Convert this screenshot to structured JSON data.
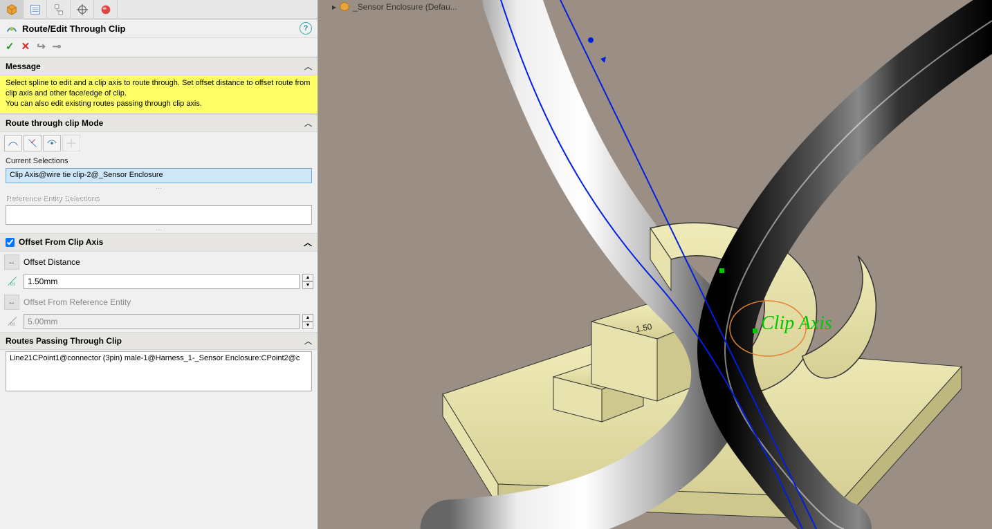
{
  "title": "Route/Edit Through Clip",
  "vp_title": "_Sensor Enclosure  (Defau...",
  "message": {
    "header": "Message",
    "body_l1": "Select spline to edit and a clip axis to route through. Set offset distance to offset route from clip axis and other face/edge of clip.",
    "body_l2": "You can also edit existing routes passing through clip axis."
  },
  "mode": {
    "header": "Route through clip Mode",
    "cur_sel_label": "Current Selections",
    "cur_sel_value": "Clip Axis@wire tie clip-2@_Sensor Enclosure",
    "ref_label": "Reference Entity Selections"
  },
  "offset": {
    "header": "Offset From Clip Axis",
    "dist_label": "Offset Distance",
    "dist_value": "1.50mm",
    "ref_label": "Offset From Reference Entity",
    "ref_value": "5.00mm"
  },
  "routes": {
    "header": "Routes Passing Through Clip",
    "item": "Line21CPoint1@connector (3pin) male-1@Harness_1-_Sensor Enclosure:CPoint2@c"
  },
  "clip_axis_text": "Clip Axis"
}
